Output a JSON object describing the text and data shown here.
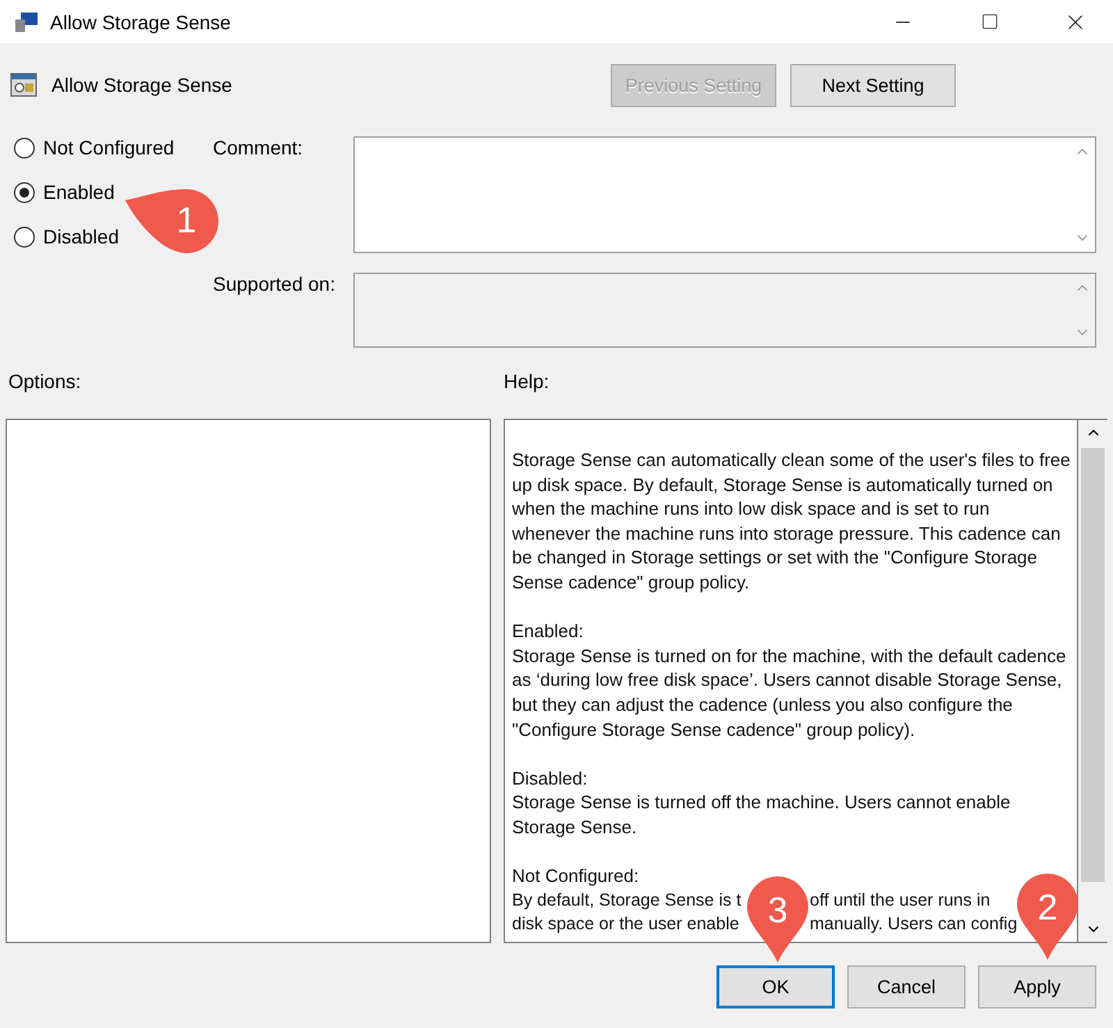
{
  "window": {
    "title": "Allow Storage Sense"
  },
  "header": {
    "title": "Allow Storage Sense",
    "buttons": [
      {
        "label": "Previous Setting",
        "disabled": true
      },
      {
        "label": "Next Setting",
        "disabled": false
      }
    ]
  },
  "options": [
    {
      "label": "Not Configured",
      "selected": false
    },
    {
      "label": "Enabled",
      "selected": true
    },
    {
      "label": "Disabled",
      "selected": false
    }
  ],
  "comment": {
    "label": "Comment:"
  },
  "supported": {
    "label": "Supported on:"
  },
  "options_label": "Options:",
  "help": {
    "label": "Help:",
    "paragraphs": [
      {
        "text": "Storage Sense can automatically clean some of the user's files to free up disk space. By default, Storage Sense is automatically turned on when the machine runs into low disk space and is set to run whenever the machine runs into storage pressure. This cadence can be changed in Storage settings or set with the \"Configure Storage Sense cadence\" group policy."
      },
      {
        "heading": "Enabled:",
        "text": "Storage Sense is turned on for the machine, with the default cadence as ‘during low free disk space’. Users cannot disable Storage Sense, but they can adjust the cadence (unless you also configure the \"Configure Storage Sense cadence\" group policy)."
      },
      {
        "heading": "Disabled:",
        "text": "Storage Sense is turned off the machine. Users cannot enable Storage Sense."
      },
      {
        "heading": "Not Configured:",
        "lines": [
          [
            "By default, Storage Sense is t",
            "off until the user runs in"
          ],
          [
            "disk space or the user enable",
            "manually. Users can config"
          ]
        ]
      }
    ]
  },
  "buttons": [
    {
      "label": "OK",
      "default": true
    },
    {
      "label": "Cancel",
      "default": false
    },
    {
      "label": "Apply",
      "default": false
    }
  ],
  "callouts": [
    {
      "label": "1",
      "kind": "left"
    },
    {
      "label": "3",
      "kind": "down"
    },
    {
      "label": "2",
      "kind": "down"
    }
  ]
}
